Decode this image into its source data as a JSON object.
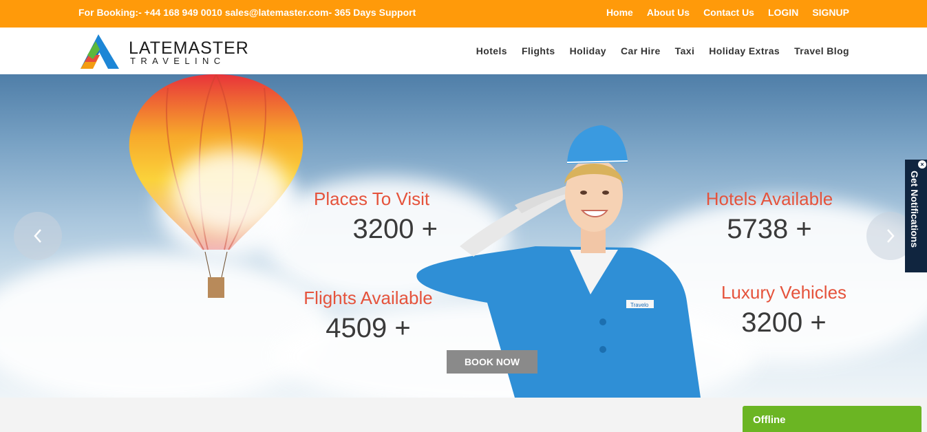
{
  "topbar": {
    "contact": "For Booking:- +44 168 949 0010  sales@latemaster.com- 365 Days Support",
    "links": [
      "Home",
      "About Us",
      "Contact Us",
      "LOGIN",
      "SIGNUP"
    ]
  },
  "logo": {
    "line1": "LATEMASTER",
    "line2": "TRAVELINC"
  },
  "nav": [
    "Hotels",
    "Flights",
    "Holiday",
    "Car Hire",
    "Taxi",
    "Holiday Extras",
    "Travel Blog"
  ],
  "stats": {
    "places": {
      "label": "Places To Visit",
      "value": "3200 +"
    },
    "flights": {
      "label": "Flights Available",
      "value": "4509 +"
    },
    "hotels": {
      "label": "Hotels Available",
      "value": "5738 +"
    },
    "vehicles": {
      "label": "Luxury Vehicles",
      "value": "3200 +"
    }
  },
  "hero": {
    "book_label": "BOOK NOW",
    "prev_icon": "chevron-left-icon",
    "next_icon": "chevron-right-icon",
    "badge_text": "Travelo"
  },
  "notification": {
    "label": "Get Notifications",
    "close": "×"
  },
  "chat": {
    "status": "Offline"
  },
  "colors": {
    "topbar": "#ff9a0a",
    "stat_label": "#e5533c",
    "stat_value": "#3a3a3a",
    "chat": "#6bb523",
    "notification": "#10253f"
  }
}
